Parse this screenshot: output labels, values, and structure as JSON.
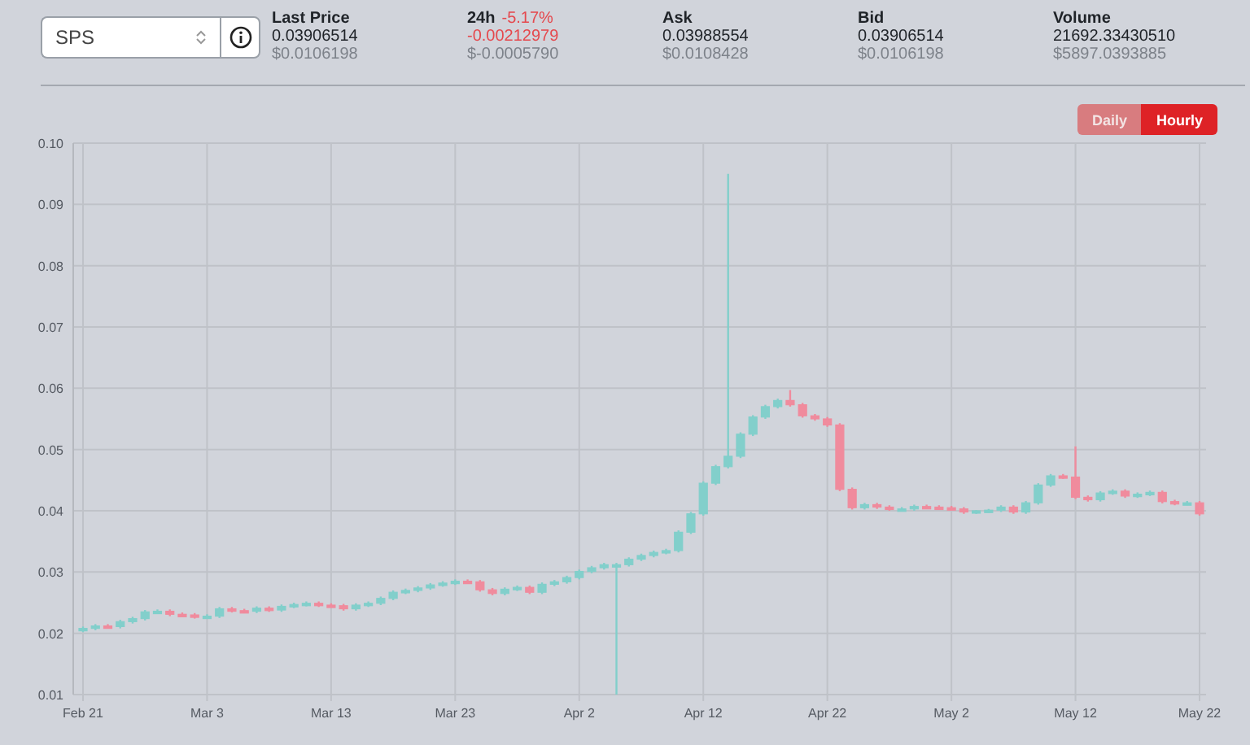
{
  "pair_select": {
    "value": "SPS"
  },
  "stats": [
    {
      "label": "Last Price",
      "kind": "plain",
      "value": "0.03906514",
      "usd": "$0.0106198"
    },
    {
      "label": "24h",
      "change": "-5.17%",
      "kind": "change",
      "value": "-0.00212979",
      "usd": "$-0.0005790"
    },
    {
      "label": "Ask",
      "kind": "plain",
      "value": "0.03988554",
      "usd": "$0.0108428"
    },
    {
      "label": "Bid",
      "kind": "plain",
      "value": "0.03906514",
      "usd": "$0.0106198"
    },
    {
      "label": "Volume",
      "kind": "plain",
      "value": "21692.33430510",
      "usd": "$5897.0393885"
    }
  ],
  "intervals": [
    {
      "label": "Daily",
      "selected": false
    },
    {
      "label": "Hourly",
      "selected": true
    }
  ],
  "chart": {
    "chart_data": {
      "type": "candlestick",
      "grid": true,
      "ylim": [
        0.01,
        0.1
      ],
      "categories": [
        "Feb 21",
        null,
        null,
        null,
        null,
        null,
        null,
        null,
        null,
        null,
        "Mar 3",
        null,
        null,
        null,
        null,
        null,
        null,
        null,
        null,
        null,
        "Mar 13",
        null,
        null,
        null,
        null,
        null,
        null,
        null,
        null,
        null,
        "Mar 23",
        null,
        null,
        null,
        null,
        null,
        null,
        null,
        null,
        null,
        "Apr 2",
        null,
        null,
        null,
        null,
        null,
        null,
        null,
        null,
        null,
        "Apr 12",
        null,
        null,
        null,
        null,
        null,
        null,
        null,
        null,
        null,
        "Apr 22",
        null,
        null,
        null,
        null,
        null,
        null,
        null,
        null,
        null,
        "May 2",
        null,
        null,
        null,
        null,
        null,
        null,
        null,
        null,
        null,
        "May 12",
        null,
        null,
        null,
        null,
        null,
        null,
        null,
        null,
        null,
        "May 22"
      ],
      "yticks": [
        {
          "value": 0.01,
          "label": "0.01"
        },
        {
          "value": 0.02,
          "label": "0.02"
        },
        {
          "value": 0.03,
          "label": "0.03"
        },
        {
          "value": 0.04,
          "label": "0.04"
        },
        {
          "value": 0.05,
          "label": "0.05"
        },
        {
          "value": 0.06,
          "label": "0.06"
        },
        {
          "value": 0.07,
          "label": "0.07"
        },
        {
          "value": 0.08,
          "label": "0.08"
        },
        {
          "value": 0.09,
          "label": "0.09"
        },
        {
          "value": 0.1,
          "label": "0.10"
        }
      ],
      "ohlc": [
        [
          0.0205,
          0.0211,
          0.0202,
          0.0208
        ],
        [
          0.0208,
          0.0215,
          0.0205,
          0.0212
        ],
        [
          0.0212,
          0.0215,
          0.0208,
          0.0211
        ],
        [
          0.0211,
          0.0222,
          0.0208,
          0.0219
        ],
        [
          0.0219,
          0.0227,
          0.0216,
          0.0224
        ],
        [
          0.0224,
          0.0238,
          0.0221,
          0.0235
        ],
        [
          0.0235,
          0.0239,
          0.0232,
          0.0236
        ],
        [
          0.0236,
          0.0239,
          0.0228,
          0.0231
        ],
        [
          0.0231,
          0.0234,
          0.0227,
          0.023
        ],
        [
          0.023,
          0.0233,
          0.0224,
          0.0227
        ],
        [
          0.0227,
          0.0231,
          0.0224,
          0.0228
        ],
        [
          0.0228,
          0.0243,
          0.0225,
          0.024
        ],
        [
          0.024,
          0.0243,
          0.0234,
          0.0237
        ],
        [
          0.0237,
          0.024,
          0.0233,
          0.0236
        ],
        [
          0.0236,
          0.0244,
          0.0233,
          0.0241
        ],
        [
          0.0241,
          0.0244,
          0.0235,
          0.0238
        ],
        [
          0.0238,
          0.0247,
          0.0235,
          0.0244
        ],
        [
          0.0244,
          0.025,
          0.0241,
          0.0247
        ],
        [
          0.0247,
          0.0252,
          0.0244,
          0.0249
        ],
        [
          0.0249,
          0.0252,
          0.0243,
          0.0246
        ],
        [
          0.0246,
          0.0249,
          0.0242,
          0.0245
        ],
        [
          0.0245,
          0.0248,
          0.0237,
          0.024
        ],
        [
          0.024,
          0.0249,
          0.0237,
          0.0246
        ],
        [
          0.0246,
          0.0252,
          0.0243,
          0.0249
        ],
        [
          0.0249,
          0.026,
          0.0246,
          0.0257
        ],
        [
          0.0257,
          0.027,
          0.0254,
          0.0267
        ],
        [
          0.0267,
          0.0273,
          0.0264,
          0.027
        ],
        [
          0.027,
          0.0277,
          0.0267,
          0.0274
        ],
        [
          0.0274,
          0.0282,
          0.0271,
          0.0279
        ],
        [
          0.0279,
          0.0285,
          0.0276,
          0.0282
        ],
        [
          0.0282,
          0.0288,
          0.0279,
          0.0285
        ],
        [
          0.0285,
          0.0288,
          0.0281,
          0.0284
        ],
        [
          0.0284,
          0.0287,
          0.0268,
          0.0271
        ],
        [
          0.0271,
          0.0274,
          0.0262,
          0.0265
        ],
        [
          0.0265,
          0.0275,
          0.0262,
          0.0272
        ],
        [
          0.0272,
          0.0278,
          0.0269,
          0.0275
        ],
        [
          0.0275,
          0.0278,
          0.0264,
          0.0267
        ],
        [
          0.0267,
          0.0283,
          0.0264,
          0.028
        ],
        [
          0.028,
          0.0287,
          0.0277,
          0.0284
        ],
        [
          0.0284,
          0.0294,
          0.0281,
          0.0291
        ],
        [
          0.0291,
          0.0304,
          0.0288,
          0.0301
        ],
        [
          0.0301,
          0.031,
          0.0298,
          0.0307
        ],
        [
          0.0307,
          0.0315,
          0.0304,
          0.0312
        ],
        [
          0.0312,
          0.0315,
          0.01,
          0.0312
        ],
        [
          0.0312,
          0.0324,
          0.0309,
          0.0321
        ],
        [
          0.0321,
          0.033,
          0.0318,
          0.0327
        ],
        [
          0.0327,
          0.0335,
          0.0324,
          0.0332
        ],
        [
          0.0332,
          0.0338,
          0.0329,
          0.0335
        ],
        [
          0.0335,
          0.0368,
          0.0332,
          0.0365
        ],
        [
          0.0365,
          0.0398,
          0.0362,
          0.0395
        ],
        [
          0.0395,
          0.0448,
          0.0392,
          0.0445
        ],
        [
          0.0445,
          0.0475,
          0.0442,
          0.0472
        ],
        [
          0.0472,
          0.095,
          0.0469,
          0.0489
        ],
        [
          0.0489,
          0.0528,
          0.0486,
          0.0525
        ],
        [
          0.0525,
          0.0556,
          0.0522,
          0.0553
        ],
        [
          0.0553,
          0.0573,
          0.055,
          0.057
        ],
        [
          0.057,
          0.0583,
          0.0567,
          0.058
        ],
        [
          0.058,
          0.0597,
          0.057,
          0.0573
        ],
        [
          0.0573,
          0.0576,
          0.0552,
          0.0555
        ],
        [
          0.0555,
          0.0558,
          0.0547,
          0.055
        ],
        [
          0.055,
          0.0553,
          0.0537,
          0.054
        ],
        [
          0.054,
          0.0543,
          0.0432,
          0.0435
        ],
        [
          0.0435,
          0.0438,
          0.0402,
          0.0405
        ],
        [
          0.0405,
          0.0413,
          0.0402,
          0.041
        ],
        [
          0.041,
          0.0413,
          0.0403,
          0.0406
        ],
        [
          0.0406,
          0.0409,
          0.04,
          0.0403
        ],
        [
          0.0403,
          0.0406,
          0.04,
          0.0403
        ],
        [
          0.0403,
          0.041,
          0.04,
          0.0407
        ],
        [
          0.0407,
          0.041,
          0.0403,
          0.0406
        ],
        [
          0.0406,
          0.0409,
          0.0402,
          0.0405
        ],
        [
          0.0405,
          0.0408,
          0.04,
          0.0403
        ],
        [
          0.0403,
          0.0406,
          0.0395,
          0.0398
        ],
        [
          0.0398,
          0.0401,
          0.0395,
          0.04
        ],
        [
          0.04,
          0.0403,
          0.0397,
          0.0401
        ],
        [
          0.0401,
          0.0409,
          0.0398,
          0.0406
        ],
        [
          0.0406,
          0.0409,
          0.0395,
          0.0398
        ],
        [
          0.0398,
          0.0416,
          0.0395,
          0.0413
        ],
        [
          0.0413,
          0.0445,
          0.041,
          0.0442
        ],
        [
          0.0442,
          0.046,
          0.0439,
          0.0457
        ],
        [
          0.0457,
          0.046,
          0.0452,
          0.0455
        ],
        [
          0.0455,
          0.0505,
          0.0419,
          0.0422
        ],
        [
          0.0422,
          0.0425,
          0.0415,
          0.0418
        ],
        [
          0.0418,
          0.0432,
          0.0415,
          0.0429
        ],
        [
          0.0429,
          0.0435,
          0.0426,
          0.0432
        ],
        [
          0.0432,
          0.0435,
          0.0421,
          0.0424
        ],
        [
          0.0424,
          0.043,
          0.0421,
          0.0427
        ],
        [
          0.0427,
          0.0433,
          0.0424,
          0.043
        ],
        [
          0.043,
          0.0433,
          0.0412,
          0.0415
        ],
        [
          0.0415,
          0.0418,
          0.0409,
          0.0412
        ],
        [
          0.0412,
          0.0416,
          0.0409,
          0.0413
        ],
        [
          0.0413,
          0.0416,
          0.0392,
          0.0395
        ]
      ]
    }
  }
}
